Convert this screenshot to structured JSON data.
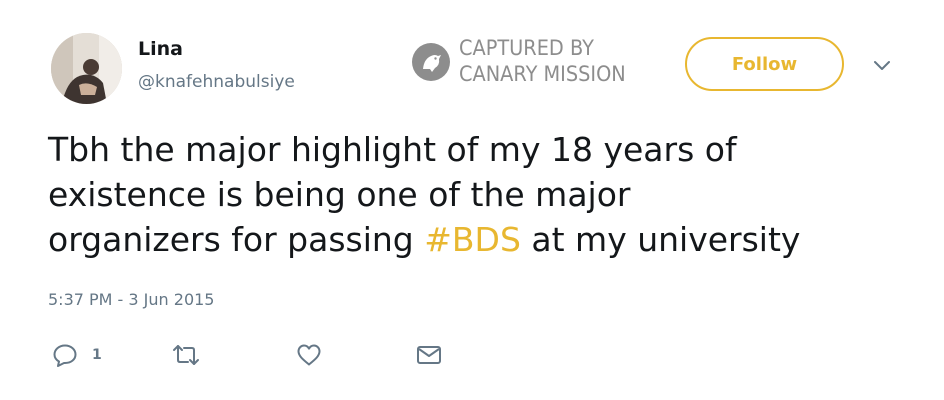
{
  "user": {
    "name": "Lina",
    "handle": "@knafehnabulsiye",
    "avatar_icon": "profile-photo"
  },
  "watermark": {
    "line1": "CAPTURED BY",
    "line2": "CANARY MISSION",
    "icon": "canary-logo-icon"
  },
  "follow": {
    "label": "Follow"
  },
  "tweet": {
    "line1": "Tbh the major highlight of my 18 years of",
    "line2": "existence is being one of the major",
    "line3_before": "organizers for passing ",
    "hashtag": "#BDS",
    "line3_after": " at my university"
  },
  "timestamp": "5:37 PM - 3 Jun 2015",
  "actions": {
    "reply_count": "1",
    "reply_icon": "reply-icon",
    "retweet_icon": "retweet-icon",
    "like_icon": "heart-icon",
    "message_icon": "envelope-icon"
  },
  "colors": {
    "accent": "#e8b730",
    "text": "#14171a",
    "secondary": "#657786",
    "watermark": "#8d8d8d"
  }
}
